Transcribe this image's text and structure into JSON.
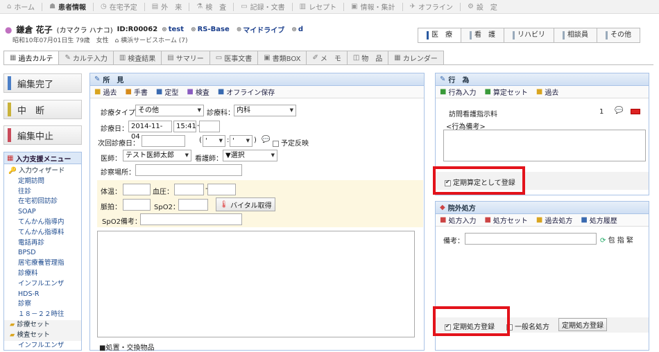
{
  "nav": [
    {
      "label": "ホーム",
      "icon": "house-icon"
    },
    {
      "label": "患者情報",
      "icon": "person-icon",
      "active": true
    },
    {
      "label": "在宅予定",
      "icon": "calendar-icon"
    },
    {
      "label": "外　来",
      "icon": "hospital-icon"
    },
    {
      "label": "検　査",
      "icon": "lab-icon"
    },
    {
      "label": "記録・文書",
      "icon": "document-icon"
    },
    {
      "label": "レセプト",
      "icon": "receipt-icon"
    },
    {
      "label": "情報・集計",
      "icon": "chart-icon"
    },
    {
      "label": "オフライン",
      "icon": "offline-icon"
    },
    {
      "label": "設　定",
      "icon": "gear-icon"
    }
  ],
  "patient": {
    "name": "鎌倉 花子",
    "kana": "(カマクラ ハナコ)",
    "id": "ID:R00062",
    "tags": [
      "test",
      "RS-Base",
      "マイドライブ",
      "d"
    ],
    "birth": "昭和10年07月01日生 79歳　女性",
    "facility": "横浜サービスホーム (7)"
  },
  "dept_tabs": [
    "医　療",
    "看　護",
    "リハビリ",
    "相談員",
    "その他"
  ],
  "screen_tabs": [
    "過去カルテ",
    "カルテ入力",
    "検査結果",
    "サマリー",
    "医事文書",
    "書類BOX",
    "メ　モ",
    "物　品",
    "カレンダー"
  ],
  "left_buttons": [
    {
      "label": "編集完了",
      "color": "#4b7fc7"
    },
    {
      "label": "中　断",
      "color": "#c9b23a"
    },
    {
      "label": "編集中止",
      "color": "#c94a5a"
    }
  ],
  "menu": {
    "title": "入力支援メニュー",
    "items": [
      "入力ウィザード",
      "定期訪問",
      "往診",
      "在宅初回訪診",
      "SOAP",
      "てんかん指導内",
      "てんかん指導料",
      "電話再診",
      "BPSD",
      "居宅療養管理指",
      "診療料",
      "インフルエンザ",
      "HDS-R",
      "診察",
      "１８－２２時往"
    ],
    "folders": [
      "診療セット",
      "検査セット"
    ],
    "last": "インフルエンザ"
  },
  "findings": {
    "title": "所　見",
    "toolbar": [
      "過去",
      "手書",
      "定型",
      "検査",
      "オフライン保存"
    ],
    "type_label": "診療タイプ",
    "type_value": "その他",
    "dept_label": "診療科：",
    "dept_value": "内科",
    "date_label": "診療日：",
    "date_value": "2014-11-04",
    "time_value": "15:41",
    "next_label": "次回診療日：",
    "next_hour": "'",
    "next_min": "'",
    "reflect_label": "予定反映",
    "doctor_label": "医師：",
    "doctor_value": "テスト医師太郎",
    "nurse_label": "看護師：",
    "nurse_value": "▼選択",
    "place_label": "診察場所：",
    "temp_label": "体温：",
    "bp_label": "血圧：",
    "pulse_label": "脈拍：",
    "spo2_label": "SpO2：",
    "vital_btn": "バイタル取得",
    "spo2note_label": "SpO2備考：",
    "bottom_label": "■処置・交換物品"
  },
  "action": {
    "title": "行　為",
    "toolbar": [
      "行為入力",
      "算定セット",
      "過去"
    ],
    "row_label": "訪問看護指示料",
    "row_count": "1",
    "memo_label": "<行為備考>",
    "reg_label": "定期算定として登録"
  },
  "rx": {
    "title": "院外処方",
    "toolbar": [
      "処方入力",
      "処方セット",
      "過去処方",
      "処方履歴"
    ],
    "note_label": "備考：",
    "hint": "包 指 緊",
    "reg_label": "定期処方登録",
    "generic_label": "一般名処方",
    "reg_btn": "定期処方登録"
  }
}
